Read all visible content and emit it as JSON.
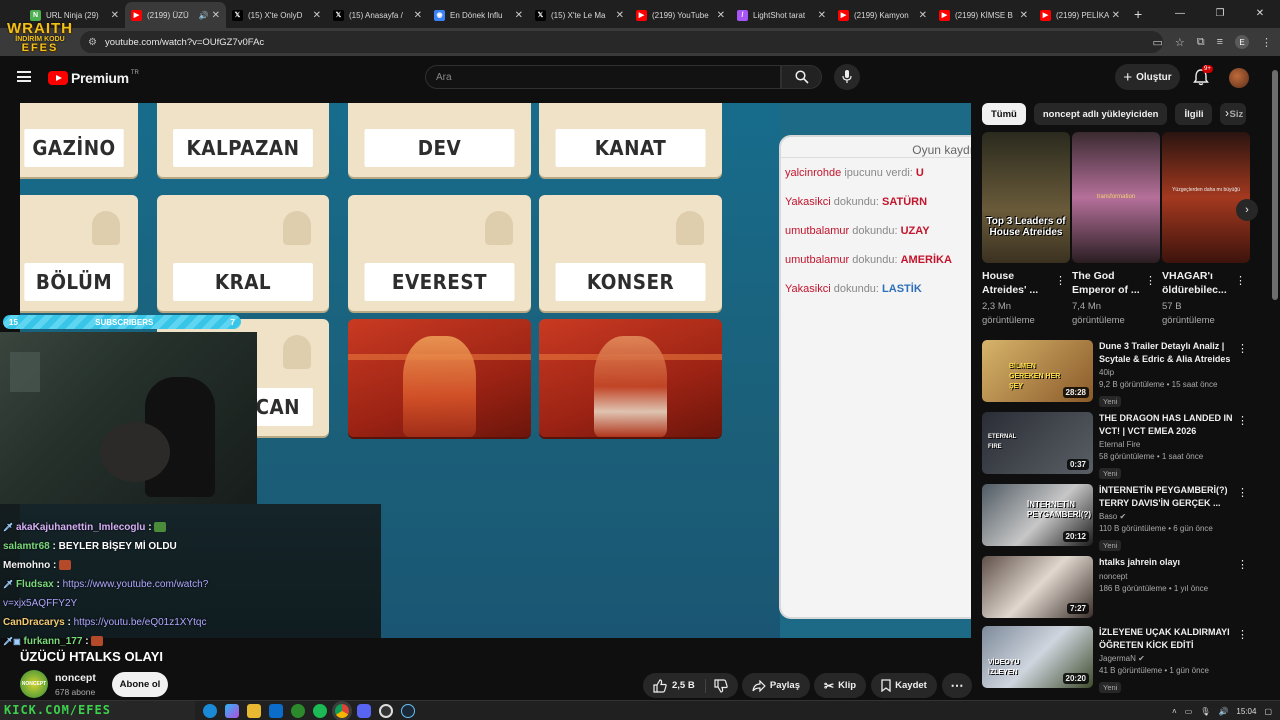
{
  "browser": {
    "tabs": [
      {
        "title": "URL Ninja (29)",
        "fav": "ninja",
        "color": "#4caf50",
        "active": false
      },
      {
        "title": "(2199) ÜZÜ",
        "fav": "youtube",
        "color": "#ff0000",
        "active": true
      },
      {
        "title": "(15) X'te OnlyD",
        "fav": "x",
        "color": "#000000",
        "active": false
      },
      {
        "title": "(15) Anasayfa /",
        "fav": "x",
        "color": "#000000",
        "active": false
      },
      {
        "title": "En Dönek Influ",
        "fav": "web",
        "color": "#3b82f6",
        "active": false
      },
      {
        "title": "(15) X'te Le Ma",
        "fav": "x",
        "color": "#000000",
        "active": false
      },
      {
        "title": "(2199) YouTube",
        "fav": "youtube",
        "color": "#ff0000",
        "active": false
      },
      {
        "title": "LightShot tarat",
        "fav": "lightshot",
        "color": "#a855f7",
        "active": false
      },
      {
        "title": "(2199) Kamyon",
        "fav": "youtube",
        "color": "#ff0000",
        "active": false
      },
      {
        "title": "(2199) KİMSE B",
        "fav": "youtube",
        "color": "#ff0000",
        "active": false
      },
      {
        "title": "(2199) PELİKAN",
        "fav": "youtube",
        "color": "#ff0000",
        "active": false
      }
    ],
    "url": "youtube.com/watch?v=OUfGZ7v0FAc"
  },
  "overlay_logo": {
    "line1": "WRAITH",
    "line2": "İNDİRİM KODU",
    "line3": "EFES"
  },
  "youtube": {
    "brand": "Premium",
    "brand_country": "TR",
    "search_placeholder": "Ara",
    "create_label": "Oluştur",
    "notifications": "9+"
  },
  "game": {
    "row1": [
      "GAZİNO",
      "KALPAZAN",
      "DEV",
      "KANAT"
    ],
    "row2": [
      "BÖLÜM",
      "KRAL",
      "EVEREST",
      "KONSER"
    ],
    "row3_left": "CAN",
    "log_title": "Oyun kaydı",
    "log": [
      {
        "who": "yalcinrohde",
        "action": "ipucunu verdi:",
        "word": "U",
        "style": "red"
      },
      {
        "who": "Yakasikci",
        "action": "dokundu:",
        "word": "SATÜRN",
        "style": "red"
      },
      {
        "who": "umutbalamur",
        "action": "dokundu:",
        "word": "UZAY",
        "style": "red"
      },
      {
        "who": "umutbalamur",
        "action": "dokundu:",
        "word": "AMERİKA",
        "style": "red"
      },
      {
        "who": "Yakasikci",
        "action": "dokundu:",
        "word": "LASTİK",
        "style": "blue"
      }
    ]
  },
  "stream": {
    "subs_left": "15",
    "subs_label": "SUBSCRIBERS",
    "subs_right": "7",
    "chat": [
      {
        "user": "akaKajuhanettin_Imlecoglu",
        "text": "",
        "link": "",
        "emote": true
      },
      {
        "user": "salamtr68",
        "text": "BEYLER BİŞEY Mİ OLDU",
        "link": "",
        "emote": false
      },
      {
        "user": "Memohno",
        "text": "",
        "link": "",
        "emote": true
      },
      {
        "user": "Fludsax",
        "text": "",
        "link": "https://www.youtube.com/watch?",
        "emote": false
      },
      {
        "user": "",
        "text": "",
        "link": "v=xjx5AQFFY2Y",
        "emote": false
      },
      {
        "user": "CanDracarys",
        "text": "",
        "link": "https://youtu.be/eQ01z1XYtqc",
        "emote": false
      },
      {
        "user": "furkann_177",
        "text": "",
        "link": "",
        "emote": true
      }
    ]
  },
  "video": {
    "title": "ÜZÜCÜ HTALKS OLAYI",
    "channel": "noncept",
    "channel_avatar": "NONCEPT",
    "subscribers": "678 abone",
    "subscribe_label": "Abone ol",
    "likes": "2,5 B",
    "share_label": "Paylaş",
    "clip_label": "Klip",
    "save_label": "Kaydet"
  },
  "sidebar": {
    "chips": [
      "Tümü",
      "noncept adlı yükleyiciden",
      "İlgili",
      "Siz"
    ],
    "shorts": [
      {
        "title1": "House",
        "title2": "Atreides' ...",
        "views1": "2,3 Mn",
        "views2": "görüntüleme",
        "thumb_text": "Top 3 Leaders of House Atreides",
        "thumb_sub": ""
      },
      {
        "title1": "The God",
        "title2": "Emperor of ...",
        "views1": "7,4 Mn",
        "views2": "görüntüleme",
        "thumb_text": "",
        "thumb_sub": "transformation"
      },
      {
        "title1": "VHAGAR'ı",
        "title2": "öldürebilec...",
        "views1": "57 B",
        "views2": "görüntüleme",
        "thumb_text": "",
        "thumb_sub": "Yüzgeçlerden daha mı büyüğü"
      }
    ],
    "recommendations": [
      {
        "title": "Dune 3 Trailer Detaylı Analiz | Scytale & Edric & Alia Atreides",
        "channel": "40ip",
        "verified": false,
        "meta": "9,2 B görüntüleme • 15 saat önce",
        "badge": "Yeni",
        "duration": "28:28",
        "thumb_text": "BİLMEN GEREKEN HER ŞEY"
      },
      {
        "title": "THE DRAGON HAS LANDED IN VCT! | VCT EMEA 2026 ROSTER",
        "channel": "Eternal Fire",
        "verified": false,
        "meta": "58 görüntüleme • 1 saat önce",
        "badge": "Yeni",
        "duration": "0:37",
        "thumb_text": "ETERNAL FIRE"
      },
      {
        "title": "İNTERNETİN PEYGAMBERİ(?) TERRY DAVIS'İN GERÇEK ...",
        "channel": "Baso",
        "verified": true,
        "meta": "110 B görüntüleme • 6 gün önce",
        "badge": "Yeni",
        "duration": "20:12",
        "thumb_text": "İNTERNETİN PEYGAMBERİ(?)"
      },
      {
        "title": "htalks jahrein olayı",
        "channel": "noncept",
        "verified": false,
        "meta": "186 B görüntüleme • 1 yıl önce",
        "badge": "",
        "duration": "7:27",
        "thumb_text": ""
      },
      {
        "title": "İZLEYENE UÇAK KALDIRMAYI ÖĞRETEN KİCK EDİTİ",
        "channel": "JagermaN",
        "verified": true,
        "meta": "41 B görüntüleme • 1 gün önce",
        "badge": "Yeni",
        "duration": "20:20",
        "thumb_text": "VİDEOYU İZLEYEN"
      }
    ]
  },
  "taskbar": {
    "logo_text": "KICK.COM/EFES",
    "clock": "15:04"
  },
  "colors": {
    "youtube_red": "#ff0000",
    "background": "#0f0f0f",
    "codenames_red": "#c3142d",
    "codenames_blue": "#2d6fb8"
  }
}
